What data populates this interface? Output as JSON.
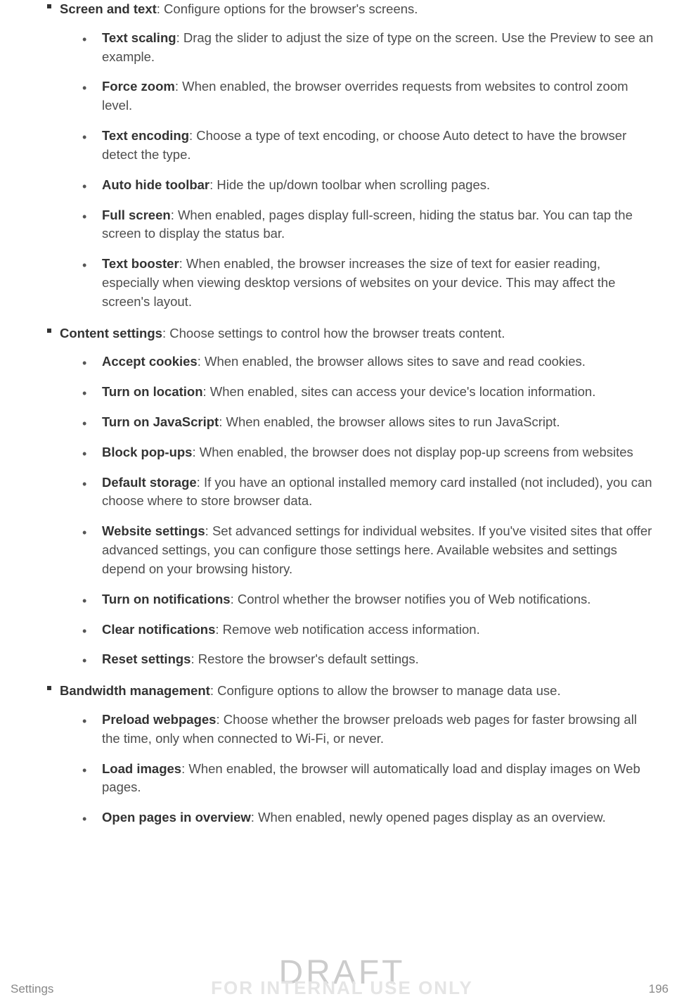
{
  "sections": [
    {
      "title": "Screen and text",
      "desc": ": Configure options for the browser's screens.",
      "items": [
        {
          "title": "Text scaling",
          "desc": ": Drag the slider to adjust the size of type on the screen. Use the Preview to see an example."
        },
        {
          "title": "Force zoom",
          "desc": ": When enabled, the browser overrides requests from websites to control zoom level."
        },
        {
          "title": "Text encoding",
          "desc": ": Choose a type of text encoding, or choose Auto detect to have the browser detect the type."
        },
        {
          "title": "Auto hide toolbar",
          "desc": ": Hide the up/down toolbar when scrolling pages."
        },
        {
          "title": "Full screen",
          "desc": ": When enabled, pages display full-screen, hiding the status bar. You can tap the screen to display the status bar."
        },
        {
          "title": "Text booster",
          "desc": ": When enabled, the browser increases the size of text for easier reading, especially when viewing desktop versions of websites on your device. This may affect the screen's layout."
        }
      ]
    },
    {
      "title": "Content settings",
      "desc": ": Choose settings to control how the browser treats content.",
      "items": [
        {
          "title": "Accept cookies",
          "desc": ": When enabled, the browser allows sites to save and read cookies."
        },
        {
          "title": "Turn on location",
          "desc": ": When enabled, sites can access your device's location information."
        },
        {
          "title": "Turn on JavaScript",
          "desc": ": When enabled, the browser allows sites to run JavaScript."
        },
        {
          "title": "Block pop-ups",
          "desc": ": When enabled, the browser does not display pop-up screens from websites"
        },
        {
          "title": "Default storage",
          "desc": ": If you have an optional installed memory card installed (not included), you can choose where to store browser data."
        },
        {
          "title": "Website settings",
          "desc": ": Set advanced settings for individual websites. If you've visited sites that offer advanced settings, you can configure those settings here. Available websites and settings depend on your browsing history."
        },
        {
          "title": "Turn on notifications",
          "desc": ": Control whether the browser notifies you of Web notifications."
        },
        {
          "title": "Clear notifications",
          "desc": ": Remove web notification access information."
        },
        {
          "title": "Reset settings",
          "desc": ": Restore the browser's default settings."
        }
      ]
    },
    {
      "title": "Bandwidth management",
      "desc": ": Configure options to allow the browser to manage data use.",
      "items": [
        {
          "title": "Preload webpages",
          "desc": ": Choose whether the browser preloads web pages for faster browsing all the time, only when connected to Wi-Fi, or never."
        },
        {
          "title": "Load images",
          "desc": ": When enabled, the browser will automatically load and display images on Web pages."
        },
        {
          "title": "Open pages in overview",
          "desc": ": When enabled, newly opened pages display as an overview."
        }
      ]
    }
  ],
  "watermark": {
    "main": "DRAFT",
    "sub": "FOR INTERNAL USE ONLY"
  },
  "footer": {
    "left": "Settings",
    "right": "196"
  }
}
